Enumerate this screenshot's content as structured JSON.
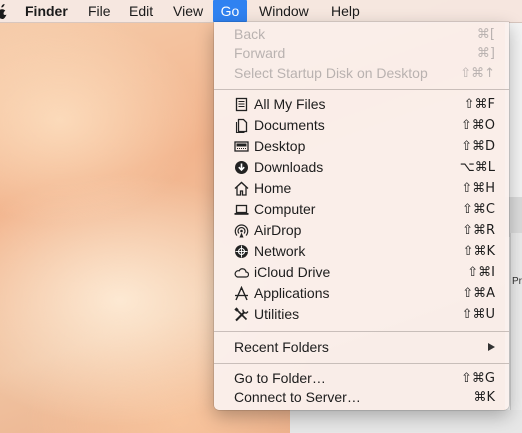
{
  "menubar": {
    "app_name": "Finder",
    "items": [
      "File",
      "Edit",
      "View",
      "Go",
      "Window",
      "Help"
    ]
  },
  "background": {
    "partial_label": "Pr"
  },
  "go_menu": {
    "navigation": [
      {
        "label": "Back",
        "shortcut": "⌘[",
        "enabled": false
      },
      {
        "label": "Forward",
        "shortcut": "⌘]",
        "enabled": false
      },
      {
        "label": "Select Startup Disk on Desktop",
        "shortcut": "⇧⌘↑",
        "enabled": false
      }
    ],
    "places": [
      {
        "label": "All My Files",
        "shortcut": "⇧⌘F",
        "icon": "all-my-files-icon"
      },
      {
        "label": "Documents",
        "shortcut": "⇧⌘O",
        "icon": "documents-icon"
      },
      {
        "label": "Desktop",
        "shortcut": "⇧⌘D",
        "icon": "desktop-icon"
      },
      {
        "label": "Downloads",
        "shortcut": "⌥⌘L",
        "icon": "downloads-icon"
      },
      {
        "label": "Home",
        "shortcut": "⇧⌘H",
        "icon": "home-icon"
      },
      {
        "label": "Computer",
        "shortcut": "⇧⌘C",
        "icon": "computer-icon"
      },
      {
        "label": "AirDrop",
        "shortcut": "⇧⌘R",
        "icon": "airdrop-icon"
      },
      {
        "label": "Network",
        "shortcut": "⇧⌘K",
        "icon": "network-icon"
      },
      {
        "label": "iCloud Drive",
        "shortcut": "⇧⌘I",
        "icon": "icloud-icon"
      },
      {
        "label": "Applications",
        "shortcut": "⇧⌘A",
        "icon": "applications-icon"
      },
      {
        "label": "Utilities",
        "shortcut": "⇧⌘U",
        "icon": "utilities-icon"
      }
    ],
    "recent_folders": {
      "label": "Recent Folders",
      "submenu_icon": "submenu-arrow-icon"
    },
    "actions": [
      {
        "label": "Go to Folder…",
        "shortcut": "⇧⌘G"
      },
      {
        "label": "Connect to Server…",
        "shortcut": "⌘K"
      }
    ]
  },
  "colors": {
    "menu_highlight": "#2f82f1",
    "disabled_text": "#b9b2b0"
  }
}
